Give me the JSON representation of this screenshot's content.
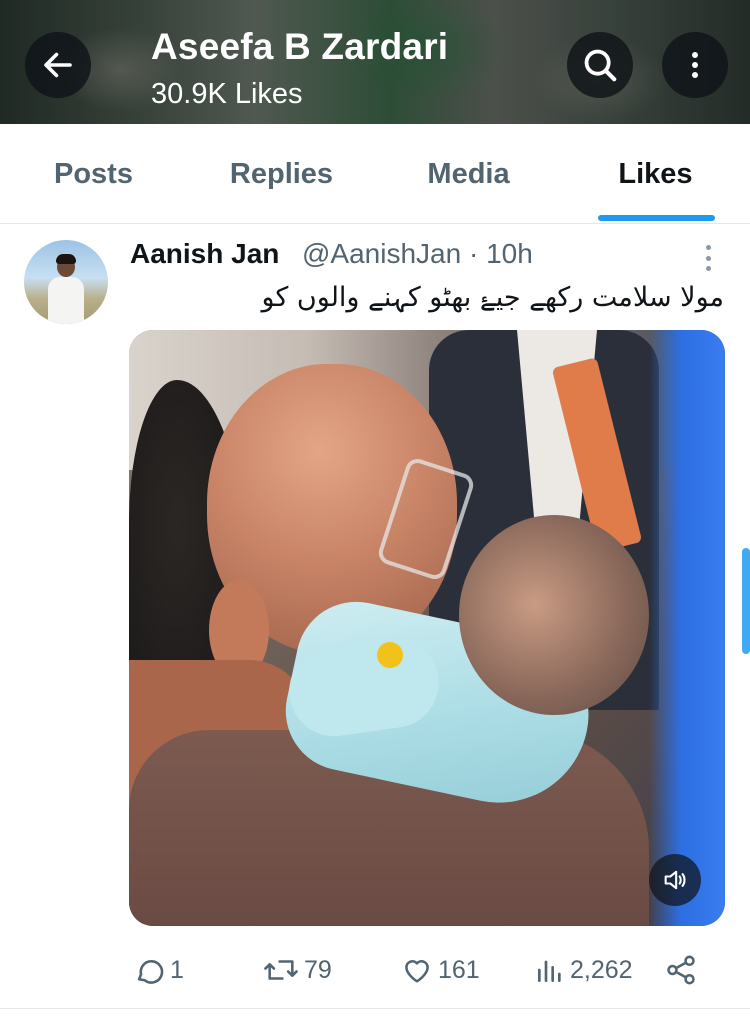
{
  "header": {
    "title": "Aseefa B Zardari",
    "subtitle": "30.9K Likes"
  },
  "tabs": [
    {
      "label": "Posts",
      "active": false
    },
    {
      "label": "Replies",
      "active": false
    },
    {
      "label": "Media",
      "active": false
    },
    {
      "label": "Likes",
      "active": true
    }
  ],
  "post": {
    "author_name": "Aanish Jan",
    "meta": "@AanishJan · 10h",
    "text": "مولا سلامت رکھے جیۓ بھٹو کہنے والوں کو",
    "media_type": "video",
    "stats": {
      "replies": "1",
      "reposts": "79",
      "likes": "161",
      "views": "2,262"
    }
  },
  "colors": {
    "accent": "#1d9bf0",
    "text_primary": "#0f1419",
    "text_secondary": "#536471"
  },
  "icons": [
    "back-arrow-icon",
    "search-icon",
    "more-vertical-icon",
    "more-icon",
    "volume-icon",
    "reply-icon",
    "repost-icon",
    "like-icon",
    "views-icon",
    "share-icon"
  ]
}
